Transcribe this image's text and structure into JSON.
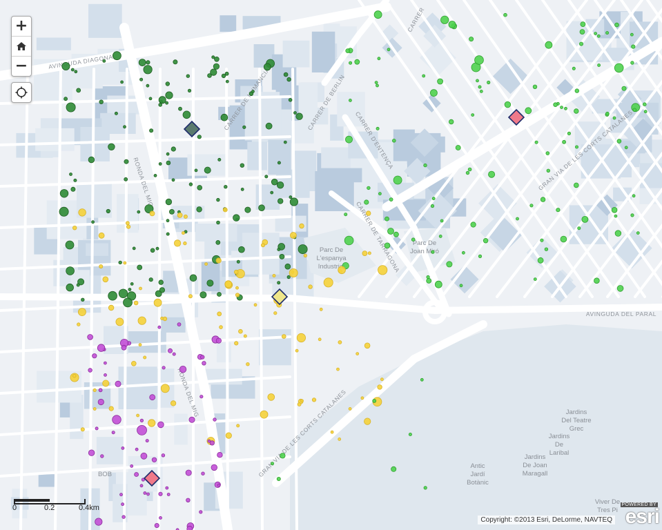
{
  "map": {
    "controls": {
      "zoom_in": "+",
      "home_icon": "home-icon",
      "zoom_out": "−",
      "locate_icon": "locate-icon"
    },
    "scale_bar": {
      "labels": [
        "0",
        "0.2",
        "0.4km"
      ]
    },
    "attribution": "Copyright: ©2013 Esri, DeLorme, NAVTEQ",
    "esri_logo": {
      "powered": "POWERED BY",
      "word": "esri"
    },
    "colors": {
      "green_dark": "#2e8b35",
      "green_light": "#4fd24f",
      "yellow": "#f5d23a",
      "purple": "#c24fd6",
      "pink": "#f07a8a",
      "water_blue": "#c3d4e4",
      "road": "#ffffff"
    },
    "road_labels": [
      {
        "text": "AVINGUDA DIAGONAL",
        "name": "road-label-avinguda-diagonal"
      },
      {
        "text": "CARRER DE BERLIN",
        "name": "road-label-carrer-de-berlin"
      },
      {
        "text": "CARRER D'ENTENÇA",
        "name": "road-label-carrer-dentenca"
      },
      {
        "text": "GRAN VIA DE LES CORTS CATALANES",
        "name": "road-label-gran-via-east"
      },
      {
        "text": "RONDA DEL MIG",
        "name": "road-label-ronda-del-mig-north"
      },
      {
        "text": "CARRER DE TARRAGONA",
        "name": "road-label-carrer-de-tarragona"
      },
      {
        "text": "AVINGUDA DEL PARAL",
        "name": "road-label-avinguda-del-paral"
      },
      {
        "text": "RONDA DEL MIG",
        "name": "road-label-ronda-del-mig-south"
      },
      {
        "text": "GRAN VIA DE LES CORTS CATALANES",
        "name": "road-label-gran-via-south"
      },
      {
        "text": "CARRER DE NUMANCIA",
        "name": "road-label-numancia"
      },
      {
        "text": "CARRER",
        "name": "road-label-carrer-top"
      }
    ],
    "place_labels": [
      {
        "lines": [
          "Parc De",
          "L'espanya",
          "Industrial"
        ],
        "name": "place-parc-espanya-industrial"
      },
      {
        "lines": [
          "Parc De",
          "Joan Miró"
        ],
        "name": "place-parc-joan-miro"
      },
      {
        "lines": [
          "Jardins",
          "Del Teatre",
          "Grec"
        ],
        "name": "place-jardins-teatre-grec"
      },
      {
        "lines": [
          "Jardins",
          "De",
          "Laribal"
        ],
        "name": "place-jardins-laribal"
      },
      {
        "lines": [
          "Jardins",
          "De Joan",
          "Maragall"
        ],
        "name": "place-jardins-joan-maragall"
      },
      {
        "lines": [
          "Antic",
          "Jardí",
          "Botànic"
        ],
        "name": "place-antic-jardi-botanic"
      },
      {
        "lines": [
          "Viver De",
          "Tres Pi"
        ],
        "name": "place-viver-tres-pins"
      },
      {
        "lines": [
          "BOB"
        ],
        "name": "place-bob"
      }
    ],
    "feature_markers": [
      {
        "color": "#5a7a6e",
        "name": "marker-diamond-dark-green"
      },
      {
        "color": "#f07a8a",
        "name": "marker-diamond-pink-north"
      },
      {
        "color": "#efe68a",
        "name": "marker-diamond-yellow"
      },
      {
        "color": "#f07a8a",
        "name": "marker-diamond-pink-south"
      }
    ]
  }
}
